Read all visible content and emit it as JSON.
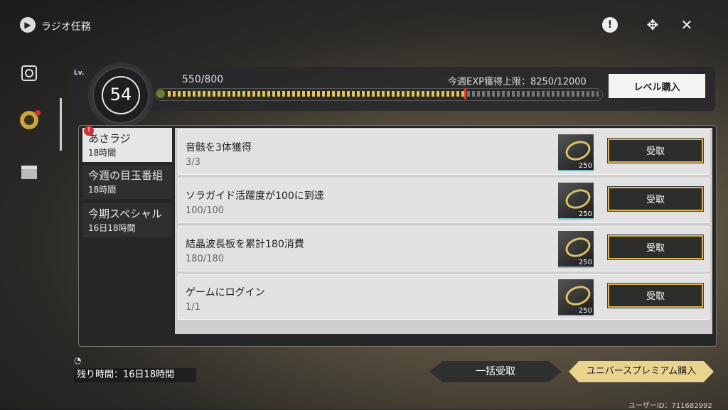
{
  "header": {
    "title": "ラジオ任務"
  },
  "nav": {
    "items": [
      "radio-icon",
      "task-icon",
      "box-icon"
    ]
  },
  "level": {
    "label": "Lv.",
    "value": "54",
    "exp_text": "550/800",
    "weekly_limit_text": "今週EXP獲得上限：8250/12000",
    "exp_fraction": 0.6875,
    "buy_label": "レベル購入"
  },
  "categories": [
    {
      "name": "あさラジ",
      "time": "18時間"
    },
    {
      "name": "今週の目玉番組",
      "time": "18時間"
    },
    {
      "name": "今期スペシャル",
      "time": "16日18時間"
    }
  ],
  "tasks": [
    {
      "name": "音骸を3体獲得",
      "progress": "3/3",
      "reward_qty": "250",
      "claim": "受取"
    },
    {
      "name": "ソラガイド活躍度が100に到達",
      "progress": "100/100",
      "reward_qty": "250",
      "claim": "受取"
    },
    {
      "name": "結晶波長板を累計180消費",
      "progress": "180/180",
      "reward_qty": "250",
      "claim": "受取"
    },
    {
      "name": "ゲームにログイン",
      "progress": "1/1",
      "reward_qty": "250",
      "claim": "受取"
    }
  ],
  "footer": {
    "remaining": "残り時間：16日18時間",
    "bulk_claim": "一括受取",
    "premium": "ユニバースプレミアム購入",
    "user_id": "ユーザーID：711682992"
  },
  "colors": {
    "accent": "#e3c34e",
    "marker": "#e4382a",
    "premium": "#e9d38f"
  }
}
